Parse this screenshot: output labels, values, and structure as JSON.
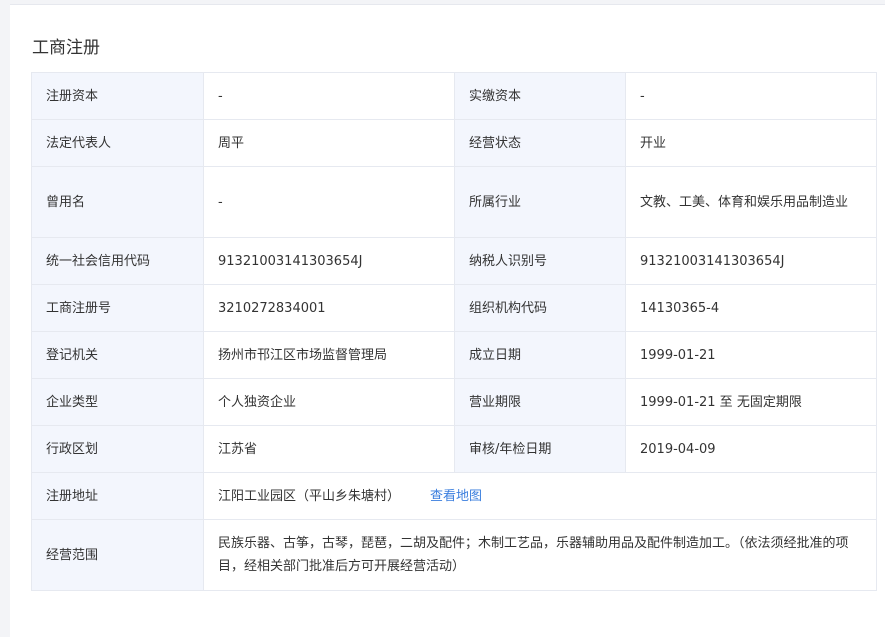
{
  "section": {
    "title": "工商注册"
  },
  "rows": [
    {
      "k1": "注册资本",
      "v1": "-",
      "k2": "实缴资本",
      "v2": "-"
    },
    {
      "k1": "法定代表人",
      "v1": "周平",
      "k2": "经营状态",
      "v2": "开业"
    },
    {
      "k1": "曾用名",
      "v1": "-",
      "k2": "所属行业",
      "v2": "文教、工美、体育和娱乐用品制造业"
    },
    {
      "k1": "统一社会信用代码",
      "v1": "91321003141303654J",
      "k2": "纳税人识别号",
      "v2": "91321003141303654J"
    },
    {
      "k1": "工商注册号",
      "v1": "3210272834001",
      "k2": "组织机构代码",
      "v2": "14130365-4"
    },
    {
      "k1": "登记机关",
      "v1": "扬州市邗江区市场监督管理局",
      "k2": "成立日期",
      "v2": "1999-01-21"
    },
    {
      "k1": "企业类型",
      "v1": "个人独资企业",
      "k2": "营业期限",
      "v2": "1999-01-21 至 无固定期限"
    },
    {
      "k1": "行政区划",
      "v1": "江苏省",
      "k2": "审核/年检日期",
      "v2": "2019-04-09"
    }
  ],
  "address": {
    "label": "注册地址",
    "value": "江阳工业园区（平山乡朱塘村）",
    "map_link": "查看地图"
  },
  "scope": {
    "label": "经营范围",
    "value": "民族乐器、古筝，古琴，琵琶，二胡及配件；木制工艺品，乐器辅助用品及配件制造加工。（依法须经批准的项目，经相关部门批准后方可开展经营活动）"
  },
  "colors": {
    "key_background": "#f3f6fd",
    "border": "#e6e9f0",
    "link": "#3a7ede",
    "page_background": "#f3f4f7"
  }
}
